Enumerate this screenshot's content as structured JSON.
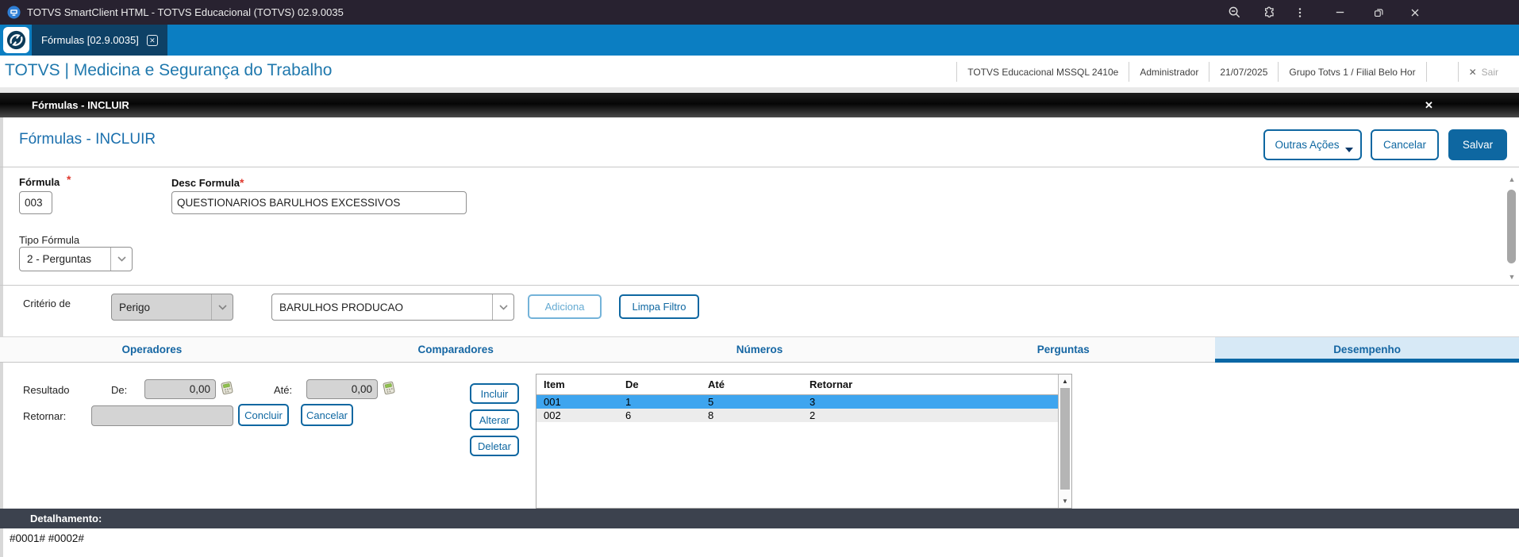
{
  "window": {
    "title": "TOTVS SmartClient HTML - TOTVS Educacional (TOTVS) 02.9.0035"
  },
  "browser_tab": {
    "label": "Fórmulas [02.9.0035]"
  },
  "header": {
    "title": "TOTVS | Medicina e Segurança do Trabalho",
    "environment": "TOTVS Educacional MSSQL 2410e",
    "user": "Administrador",
    "date": "21/07/2025",
    "branch": "Grupo Totvs 1 / Filial Belo Hor",
    "logout_label": "Sair"
  },
  "panel_bar": {
    "title": "Fórmulas - INCLUIR"
  },
  "page": {
    "title": "Fórmulas - INCLUIR",
    "other_actions_label": "Outras Ações",
    "cancel_label": "Cancelar",
    "save_label": "Salvar"
  },
  "form": {
    "formula_label": "Fórmula",
    "formula_value": "003",
    "desc_label": "Desc Formula",
    "desc_value": "QUESTIONARIOS BARULHOS EXCESSIVOS",
    "tipo_label": "Tipo Fórmula",
    "tipo_value": "2 - Perguntas",
    "required_marker": "*"
  },
  "criterio": {
    "label": "Critério de",
    "tipo_value": "Perigo",
    "valor_value": "BARULHOS PRODUCAO",
    "adiciona_label": "Adiciona",
    "limpa_label": "Limpa Filtro"
  },
  "tabs": {
    "items": [
      "Operadores",
      "Comparadores",
      "Números",
      "Perguntas",
      "Desempenho"
    ],
    "active": "Desempenho"
  },
  "desempenho": {
    "resultado_label": "Resultado",
    "de_label": "De:",
    "de_value": "0,00",
    "ate_label": "Até:",
    "ate_value": "0,00",
    "retornar_label": "Retornar:",
    "retornar_value": "",
    "concluir_label": "Concluir",
    "cancelar_label": "Cancelar",
    "incluir_label": "Incluir",
    "alterar_label": "Alterar",
    "deletar_label": "Deletar",
    "grid": {
      "columns": [
        "Item",
        "De",
        "Até",
        "Retornar"
      ],
      "rows": [
        [
          "001",
          "1",
          "5",
          "3"
        ],
        [
          "002",
          "6",
          "8",
          "2"
        ]
      ],
      "selected_row": 0
    }
  },
  "footer": {
    "detalhamento_label": "Detalhamento:",
    "detalhamento_value": "#0001# #0002#"
  },
  "icons": {
    "close": "✕",
    "arrow_up": "▲",
    "arrow_down": "▼"
  },
  "colors": {
    "accent_blue": "#0e67a1",
    "tabstrip_blue": "#0b7ec2",
    "tab_navy": "#0e4166",
    "selected_row_blue": "#3ea5ef",
    "titlebar_dark": "#282230",
    "footer_bar": "#3c424e",
    "active_tab_bg": "#d7e9f6"
  }
}
